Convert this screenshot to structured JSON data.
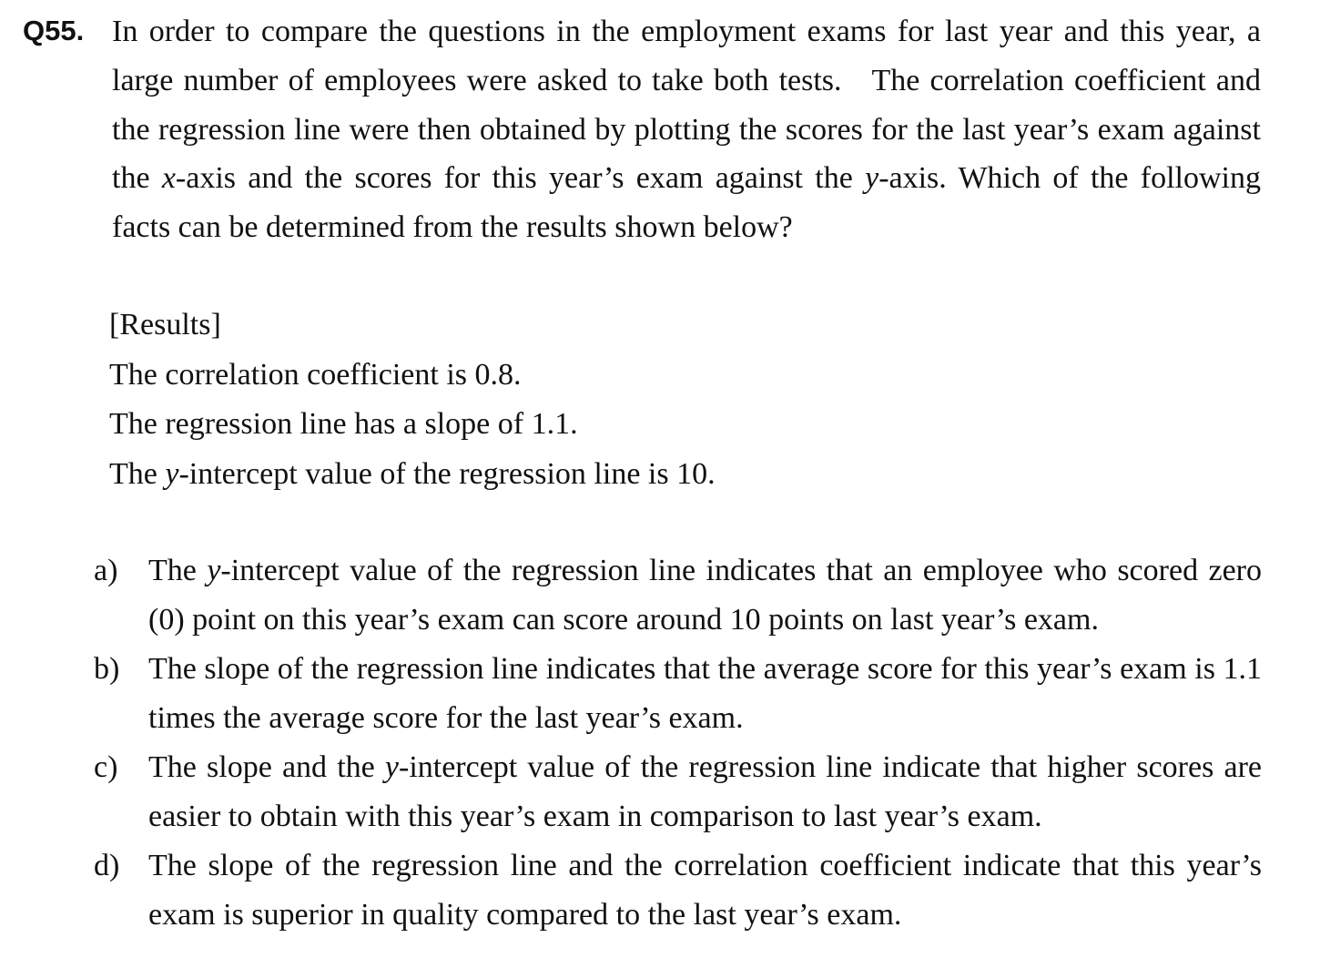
{
  "question": {
    "number": "Q55.",
    "stem": {
      "part1": "In order to compare the questions in the employment exams for last year and this year, a large number of employees were asked to take both tests.   The correlation coefficient and the regression line were then obtained by plotting the scores for the last year’s exam against the ",
      "x_var": "x",
      "part2": "-axis and the scores for this year’s exam against the ",
      "y_var": "y",
      "part3": "-axis. Which of the following facts can be determined from the results shown below?"
    }
  },
  "results": {
    "heading": "[Results]",
    "correlation": "The correlation coefficient is 0.8.",
    "slope": "The regression line has a slope of 1.1.",
    "intercept_pre": "The ",
    "intercept_var": "y",
    "intercept_post": "-intercept value of the regression line is 10."
  },
  "options": [
    {
      "label": "a)",
      "pre": "The ",
      "var": "y",
      "post": "-intercept value of the regression line indicates that an employee who scored zero (0) point on this year’s exam can score around 10 points on last year’s exam."
    },
    {
      "label": "b)",
      "text": "The slope of the regression line indicates that the average score for this year’s exam is 1.1 times the average score for the last year’s exam."
    },
    {
      "label": "c)",
      "pre": "The slope and the ",
      "var": "y",
      "post": "-intercept value of the regression line indicate that higher scores are easier to obtain with this year’s exam in comparison to last year’s exam."
    },
    {
      "label": "d)",
      "text": "The slope of the regression line and the correlation coefficient indicate that this year’s exam is superior in quality compared to the last year’s exam."
    }
  ]
}
